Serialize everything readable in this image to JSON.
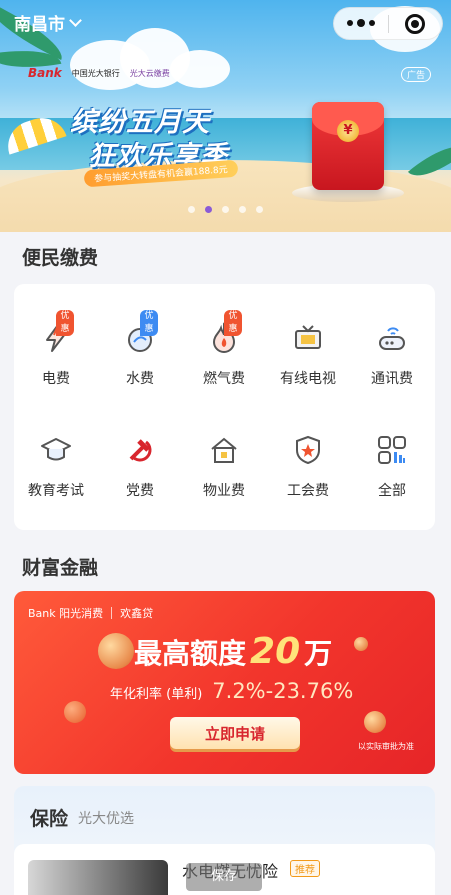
{
  "header": {
    "city": "南昌市"
  },
  "banner": {
    "bank_logo": "Bank",
    "bank_name_cn": "中国光大银行",
    "partner": "光大云缴费",
    "ad_label": "广告",
    "title_line1": "缤纷五月天",
    "title_line2": "狂欢乐享季",
    "subtitle": "参与抽奖大转盘有机会赢188.8元",
    "envelope_symbol": "¥",
    "pages": 5,
    "active_page": 1
  },
  "payments": {
    "title": "便民缴费",
    "items": [
      {
        "label": "电费",
        "icon": "electricity-icon",
        "badge": "优惠",
        "badge_color": "#f05430"
      },
      {
        "label": "水费",
        "icon": "water-icon",
        "badge": "优惠",
        "badge_color": "#3d8bf2"
      },
      {
        "label": "燃气费",
        "icon": "gas-flame-icon",
        "badge": "优惠",
        "badge_color": "#f05430"
      },
      {
        "label": "有线电视",
        "icon": "tv-icon",
        "badge": "",
        "badge_color": ""
      },
      {
        "label": "通讯费",
        "icon": "router-icon",
        "badge": "",
        "badge_color": ""
      },
      {
        "label": "教育考试",
        "icon": "graduation-cap-icon",
        "badge": "",
        "badge_color": ""
      },
      {
        "label": "党费",
        "icon": "hammer-sickle-icon",
        "badge": "",
        "badge_color": ""
      },
      {
        "label": "物业费",
        "icon": "house-icon",
        "badge": "",
        "badge_color": ""
      },
      {
        "label": "工会费",
        "icon": "union-shield-icon",
        "badge": "",
        "badge_color": ""
      },
      {
        "label": "全部",
        "icon": "grid-all-icon",
        "badge": "",
        "badge_color": ""
      }
    ]
  },
  "finance": {
    "title": "财富金融",
    "brand1": "Bank 阳光消费",
    "brand2": "欢鑫贷",
    "quota_label": "最高额度",
    "quota_amount": "20",
    "quota_unit": "万",
    "rate_label": "年化利率 (单利)",
    "rate_value": "7.2%-23.76%",
    "cta": "立即申请",
    "note": "以实际审批为准"
  },
  "insurance": {
    "title": "保险",
    "subtitle": "光大优选",
    "item_name": "水电燃无忧险",
    "item_tag": "推荐"
  },
  "toast": "保存",
  "colors": {
    "accent_red": "#e62528",
    "badge_orange": "#f05430",
    "badge_blue": "#3d8bf2",
    "page_dot_active": "#8a5bd6"
  }
}
